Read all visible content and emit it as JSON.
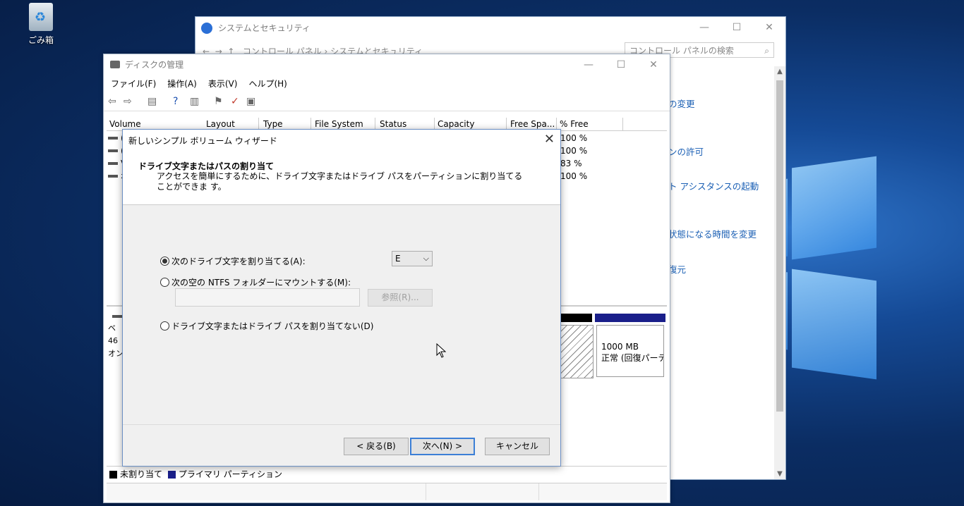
{
  "desktop": {
    "recycle_bin_label": "ごみ箱"
  },
  "control_panel": {
    "title": "システムとセキュリティ",
    "address": "コントロール パネル  ›  システムとセキュリティ",
    "search_placeholder": "コントロール パネルの検索",
    "links": [
      "の変更",
      "ンの許可",
      "ト アシスタンスの起動",
      "状態になる時間を変更",
      "復元"
    ]
  },
  "disk_mgmt": {
    "title": "ディスクの管理",
    "menu": [
      "ファイル(F)",
      "操作(A)",
      "表示(V)",
      "ヘルプ(H)"
    ],
    "columns": [
      "Volume",
      "Layout",
      "Type",
      "File System",
      "Status",
      "Capacity",
      "Free Spa...",
      "% Free"
    ],
    "rows": [
      {
        "volume": "(",
        "percent_free": "100 %"
      },
      {
        "volume": "(",
        "percent_free": "100 %"
      },
      {
        "volume": "V",
        "percent_free": "83 %"
      },
      {
        "volume": "ボ",
        "percent_free": "100 %"
      }
    ],
    "disk_label_lines": [
      "ベ",
      "46",
      "オン"
    ],
    "partition_size": "1000 MB",
    "partition_status": "正常 (回復パーテ",
    "legend": {
      "unallocated": "未割り当て",
      "primary": "プライマリ パーティション"
    },
    "colors": {
      "unallocated": "#000000",
      "primary": "#1a1f8a"
    }
  },
  "wizard": {
    "title": "新しいシンプル ボリューム ウィザード",
    "heading": "ドライブ文字またはパスの割り当て",
    "description": "アクセスを簡単にするために、ドライブ文字またはドライブ パスをパーティションに割り当てることができま す。",
    "option_assign_letter": "次のドライブ文字を割り当てる(A):",
    "option_mount_folder": "次の空の NTFS フォルダーにマウントする(M):",
    "option_no_letter": "ドライブ文字またはドライブ パスを割り当てない(D)",
    "selected_letter": "E",
    "browse_label": "参照(R)...",
    "back_label": "< 戻る(B)",
    "next_label": "次へ(N) >",
    "cancel_label": "キャンセル"
  }
}
